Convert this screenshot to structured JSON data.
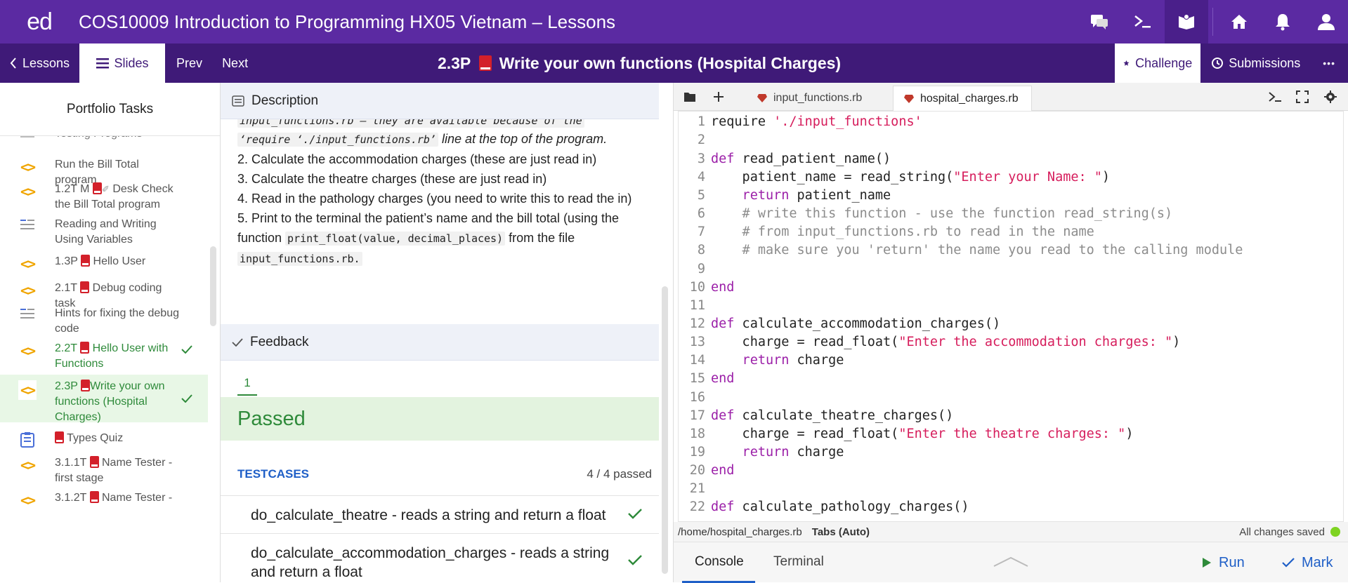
{
  "app": {
    "logo": "ed",
    "course_title": "COS10009 Introduction to Programming HX05 Vietnam – Lessons"
  },
  "nav": {
    "lessons": "Lessons",
    "slides": "Slides",
    "prev": "Prev",
    "next": "Next",
    "lesson_code": "2.3P",
    "lesson_title": "Write your own functions (Hospital Charges)",
    "challenge": "Challenge",
    "submissions": "Submissions",
    "more": "•••"
  },
  "sidebar": {
    "header": "Portfolio Tasks",
    "items": [
      {
        "label": "Testing Programs",
        "type": "list"
      },
      {
        "label": "Run the Bill Total program",
        "type": "code"
      },
      {
        "label": "1.2T M",
        "label2": "Desk Check the Bill Total program",
        "type": "code"
      },
      {
        "label": "Reading and Writing Using Variables",
        "type": "list"
      },
      {
        "label": "1.3P",
        "label2": "Hello User",
        "type": "code"
      },
      {
        "label": "2.1T",
        "label2": "Debug coding task",
        "type": "code"
      },
      {
        "label": "Hints for fixing the debug code",
        "type": "list"
      },
      {
        "label": "2.2T",
        "label2": "Hello User with Functions",
        "type": "code",
        "done": true
      },
      {
        "label": "2.3P",
        "label2": "Write your own functions (Hospital Charges)",
        "type": "code",
        "done": true,
        "current": true
      },
      {
        "label": "Types Quiz",
        "type": "quiz"
      },
      {
        "label": "3.1.1T",
        "label2": "Name Tester - first stage",
        "type": "code"
      },
      {
        "label": "3.1.2T",
        "label2": "Name Tester -",
        "type": "code"
      }
    ]
  },
  "description": {
    "heading": "Description",
    "partial_line": "input_functions.rb – they are available because of the",
    "require_chip": "‘require ‘./input_functions.rb’",
    "require_rest": " line at the top of the program.",
    "step2": "2.    Calculate the accommodation charges (these are just read in)",
    "step3": "3.    Calculate the theatre charges (these are just read in)",
    "step4": "4.    Read in the pathology charges (you need to write this to read the in)",
    "step5a": "5.    Print to the terminal the patient’s name and the bill total (using the function ",
    "step5_fn": "print_float(value, decimal_places)",
    "step5b": " from the file ",
    "step5_file": "input_functions.rb."
  },
  "feedback": {
    "heading": "Feedback",
    "tab": "1",
    "result": "Passed",
    "testcases_label": "TESTCASES",
    "testcases_count": "4 / 4 passed",
    "cases": [
      "do_calculate_theatre - reads a string and return a float",
      "do_calculate_accommodation_charges - reads a string and return a float"
    ]
  },
  "editor": {
    "tabs": [
      "input_functions.rb",
      "hospital_charges.rb"
    ],
    "path": "/home/hospital_charges.rb",
    "indent": "Tabs (Auto)",
    "saved": "All changes saved",
    "console_tab": "Console",
    "terminal_tab": "Terminal",
    "run": "Run",
    "mark": "Mark",
    "lines": [
      "1",
      "2",
      "3",
      "4",
      "5",
      "6",
      "7",
      "8",
      "9",
      "10",
      "11",
      "12",
      "13",
      "14",
      "15",
      "16",
      "17",
      "18",
      "19",
      "20",
      "21",
      "22"
    ],
    "code": {
      "l1a": "require ",
      "l1b": "'./input_functions'",
      "l3a": "def",
      "l3b": " read_patient_name()",
      "l4a": "    patient_name = read_string(",
      "l4b": "\"Enter your Name: \"",
      "l4c": ")",
      "l5a": "    return",
      "l5b": " patient_name",
      "l6": "    # write this function - use the function read_string(s)",
      "l7": "    # from input_functions.rb to read in the name",
      "l8": "    # make sure you 'return' the name you read to the calling module",
      "l10": "end",
      "l12a": "def",
      "l12b": " calculate_accommodation_charges()",
      "l13a": "    charge = read_float(",
      "l13b": "\"Enter the accommodation charges: \"",
      "l13c": ")",
      "l14a": "    return",
      "l14b": " charge",
      "l15": "end",
      "l17a": "def",
      "l17b": " calculate_theatre_charges()",
      "l18a": "    charge = read_float(",
      "l18b": "\"Enter the theatre charges: \"",
      "l18c": ")",
      "l19a": "    return",
      "l19b": " charge",
      "l20": "end",
      "l22a": "def",
      "l22b": " calculate_pathology_charges()"
    }
  },
  "colors": {
    "topbar": "#5b2aa2",
    "navbar": "#3f1a78",
    "passed": "#2e8a3a",
    "accent_blue": "#1f5fc7"
  }
}
